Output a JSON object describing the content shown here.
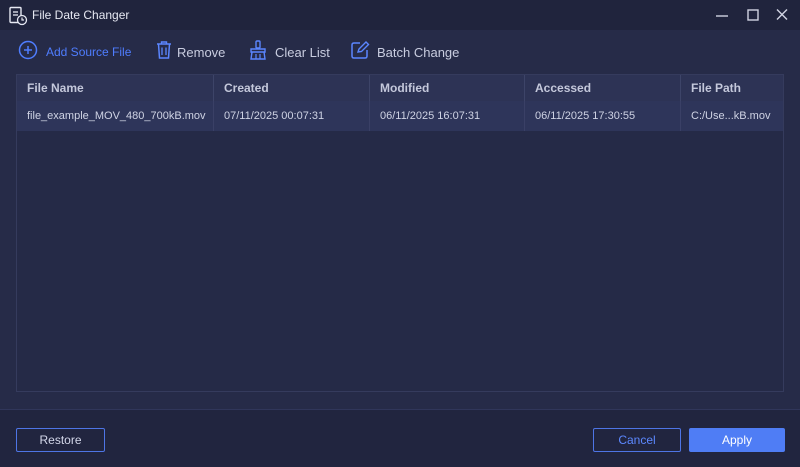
{
  "window": {
    "title": "File Date Changer",
    "icon": "file-clock-icon"
  },
  "toolbar": {
    "add_label": "Add Source File",
    "remove_label": "Remove",
    "clear_label": "Clear List",
    "batch_label": "Batch Change"
  },
  "table": {
    "columns": [
      "File Name",
      "Created",
      "Modified",
      "Accessed",
      "File Path"
    ],
    "rows": [
      {
        "name": "file_example_MOV_480_700kB.mov",
        "created": "07/11/2025 00:07:31",
        "modified": "06/11/2025 16:07:31",
        "accessed": "06/11/2025 17:30:55",
        "path": "C:/Use...kB.mov"
      }
    ]
  },
  "footer": {
    "restore_label": "Restore",
    "cancel_label": "Cancel",
    "apply_label": "Apply"
  },
  "colors": {
    "background": "#262b48",
    "titlebar": "#20243d",
    "accent": "#4f7df5",
    "selected_row": "#2e355a"
  }
}
